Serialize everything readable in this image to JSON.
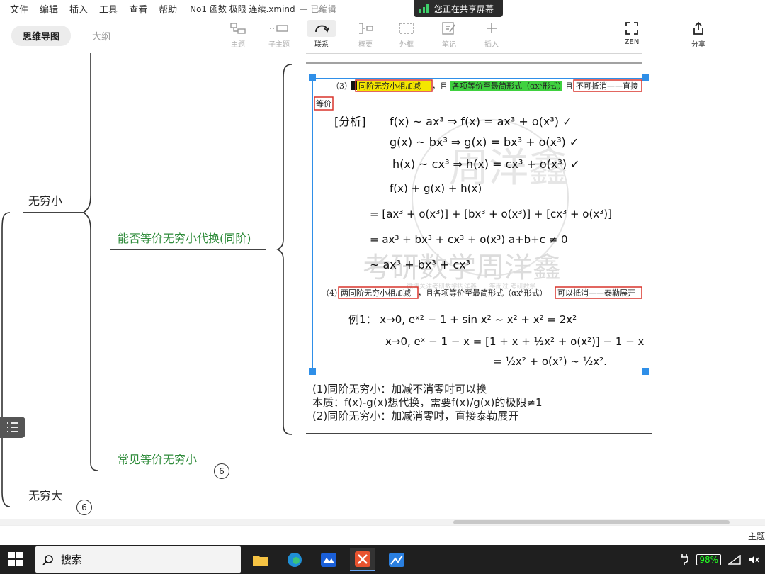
{
  "menubar": {
    "items": [
      "文件",
      "编辑",
      "插入",
      "工具",
      "查看",
      "帮助"
    ],
    "doc_title": "No1 函数 极限 连续.xmind",
    "doc_status": "— 已编辑"
  },
  "share_banner": {
    "text": "您正在共享屏幕"
  },
  "view_tabs": {
    "mindmap": "思维导图",
    "outline": "大纲"
  },
  "toolbar": {
    "topic": "主题",
    "subtopic": "子主题",
    "relationship": "联系",
    "summary": "概要",
    "boundary": "外框",
    "notes": "笔记",
    "insert": "插入",
    "zen": "ZEN",
    "share": "分享"
  },
  "mindmap": {
    "node_infinitesimal": "无穷小",
    "node_infinity": "无穷大",
    "node_equiv_substitution": "能否等价无穷小代换(同阶)",
    "node_common_equiv": "常见等价无穷小",
    "collapsed_common_equiv": "6",
    "collapsed_infinity": "6",
    "note_lines": [
      "(1)同阶无穷小：加减不消零时可以换",
      "本质：f(x)-g(x)想代换，需要f(x)/g(x)的极限≠1",
      "(2)同阶无穷小：加减消零时，直接泰勒展开"
    ]
  },
  "note_image": {
    "case3_num": "（3）",
    "case3_a": "同阶无穷小相加减",
    "case3_mid": "，且",
    "case3_b": "各项等价至最简形式（αxᵏ形式）",
    "case3_c": "且",
    "case3_d": "不可抵消——直接",
    "case3_e": "等价",
    "analysis": "[分析]",
    "hw_lines": [
      "f(x) ~ ax³   ⇒  f(x) = ax³ + o(x³) ✓",
      "g(x) ~ bx³   ⇒  g(x) = bx³ + o(x³) ✓",
      "h(x) ~ cx³   ⇒  h(x) = cx³ + o(x³) ✓",
      "f(x) + g(x) + h(x)",
      "= [ax³ + o(x³)] + [bx³ + o(x³)] + [cx³ + o(x³)]",
      "= ax³ + bx³ + cx³ + o(x³)          a+b+c ≠ 0",
      "~ ax³ + bx³ + cx³"
    ],
    "case4_num": "（4）",
    "case4_a": "两同阶无穷小相加减",
    "case4_mid": "，且各项等价至最简形式（αxᵏ形式）",
    "case4_b": "可以抵消——泰勒展开",
    "ex_lines": [
      "例1：  x→0,   eˣ² − 1 + sin x²  ~ x² + x² = 2x²",
      "x→0,   eˣ − 1 − x = [1 + x + ½x² + o(x²)] − 1 − x",
      "= ½x² + o(x²) ~ ½x²."
    ],
    "watermark_top": "周洋鑫",
    "watermark_main": "考研数学周洋鑫",
    "watermark_sub": "微博关注考研数学周洋鑫 | 一笑而过 考研数学"
  },
  "statusbar": {
    "right": "主题"
  },
  "taskbar": {
    "search": "搜索",
    "battery": "98%"
  },
  "colors": {
    "accent": "#2f8fe8",
    "node_green": "#2e8b3a",
    "highlight_yellow": "#f4e600",
    "highlight_green": "#3fd13f",
    "box_red": "#d9342b",
    "ink_purple": "#5a3ea8"
  },
  "icons": [
    "topic-icon",
    "subtopic-icon",
    "relationship-icon",
    "summary-icon",
    "boundary-icon",
    "notes-icon",
    "plus-icon",
    "zen-icon",
    "share-icon",
    "outline-list-icon",
    "windows-icon",
    "search-icon",
    "battery-icon"
  ]
}
